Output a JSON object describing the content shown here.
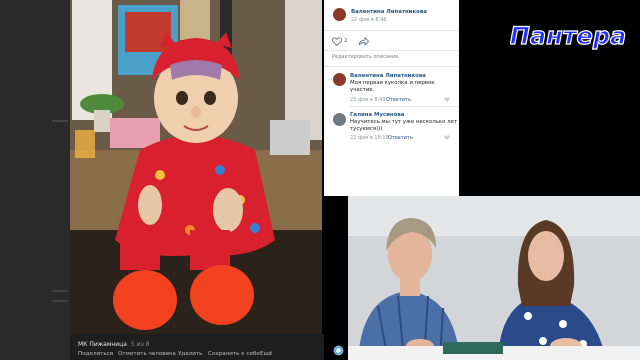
{
  "post": {
    "author": "Валентина Липатникова",
    "date": "22 фев в 8:46",
    "likes": "2",
    "edit_description": "Редактировать описание"
  },
  "comments": [
    {
      "author": "Валентина Липатникова",
      "text_line1": "Моя первая куколка и первое",
      "text_line2": "участие.",
      "date": "22 фев в 8:49",
      "reply": "Ответить"
    },
    {
      "author": "Галина Мусинова",
      "text_line1": "Научитесь,мы тут уже несколько лет",
      "text_line2": "тусуемся)))",
      "date": "22 фев в 16:15",
      "reply": "Ответить"
    }
  ],
  "photo_bar": {
    "album": "МК Пижамница",
    "counter": "5 из 8",
    "actions": [
      "Поделиться",
      "Отметить человека",
      "Удалить",
      "Сохранить к себе",
      "Ещё"
    ]
  },
  "logo_text": "Пантера",
  "colors": {
    "vk_link": "#2a5885",
    "logo_blue": "#1e2dff",
    "pajama_red": "#d8202f"
  }
}
